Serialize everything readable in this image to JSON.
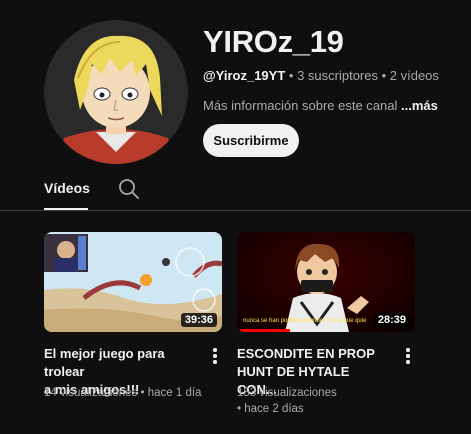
{
  "channel": {
    "name": "YIROz_19",
    "handle": "@Yiroz_19YT",
    "separator1": " • ",
    "subscribers": "3 suscriptores",
    "separator2": " • ",
    "videos_count": "2 vídeos",
    "about_text": "Más información sobre este canal ",
    "about_more": "...más",
    "subscribe_label": "Suscribirme"
  },
  "tabs": {
    "videos_label": "Vídeos",
    "search_icon": "search-icon"
  },
  "videos": [
    {
      "title_line1": "El mejor juego para trolear",
      "title_line2": "a mis amigos!!!",
      "duration": "39:36",
      "meta": "14 visualizaciones • hace 1 día"
    },
    {
      "title_line1": "ESCONDITE EN PROP",
      "title_line2": "HUNT DE HYTALE CON...",
      "duration": "28:39",
      "views": "153 visualizaciones",
      "age": "• hace 2 días",
      "thumb_caption": "nunca se han podido esconder. En la que quie",
      "progress": 0.3
    }
  ],
  "colors": {
    "background": "#0f0f0f",
    "text_primary": "#f1f1f1",
    "text_secondary": "#aaaaaa",
    "progress": "#ff0000"
  }
}
